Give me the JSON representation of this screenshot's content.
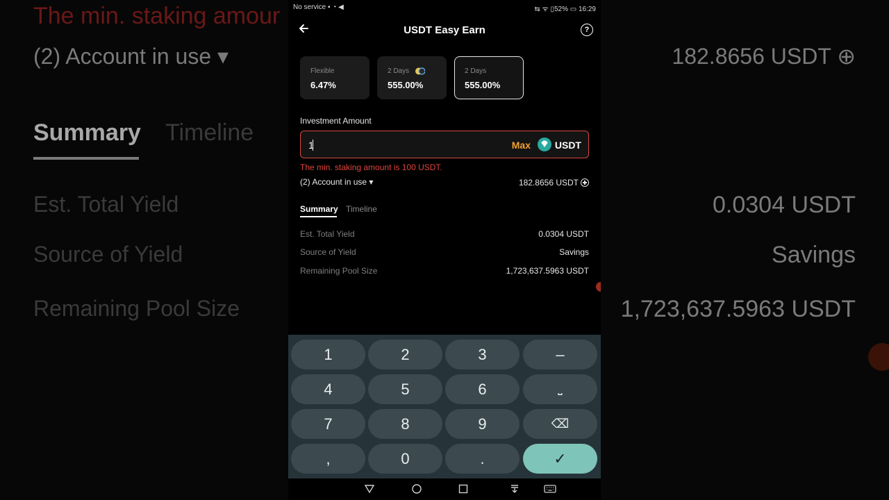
{
  "background": {
    "error_text": "The min. staking amour",
    "account": "(2) Account in use ▾",
    "balance": "182.8656 USDT ⊕",
    "tab_summary": "Summary",
    "tab_timeline": "Timeline",
    "rows": [
      {
        "label": "Est. Total Yield",
        "value": "0.0304 USDT"
      },
      {
        "label": "Source of Yield",
        "value": "Savings"
      },
      {
        "label": "Remaining Pool Size",
        "value": "1,723,637.5963 USDT"
      }
    ]
  },
  "status_bar": {
    "left": "No service ▪ ◔ ◀",
    "right": "⇆ ᯤ ▯52% ▭ 16:29"
  },
  "header": {
    "title": "USDT Easy Earn",
    "back_icon": "arrow-left-icon",
    "help_icon": "question-circle-icon",
    "help_glyph": "?"
  },
  "plans": [
    {
      "label": "Flexible",
      "rate": "6.47%"
    },
    {
      "label": "2 Days",
      "rate": "555.00%"
    },
    {
      "label": "2 Days",
      "rate": "555.00%"
    }
  ],
  "investment": {
    "label": "Investment Amount",
    "value": "1",
    "max_label": "Max",
    "currency": "USDT",
    "error": "The min. staking amount is 100 USDT."
  },
  "account": {
    "label": "(2) Account in use ▾",
    "balance": "182.8656 USDT"
  },
  "tabs": {
    "summary": "Summary",
    "timeline": "Timeline"
  },
  "summary_rows": [
    {
      "label": "Est. Total Yield",
      "value": "0.0304 USDT"
    },
    {
      "label": "Source of Yield",
      "value": "Savings"
    },
    {
      "label": "Remaining Pool Size",
      "value": "1,723,637.5963 USDT"
    }
  ],
  "keypad": {
    "keys": [
      "1",
      "2",
      "3",
      "–",
      "4",
      "5",
      "6",
      "⎵",
      "7",
      "8",
      "9",
      "⌫",
      ",",
      "0",
      ".",
      "✓"
    ]
  },
  "colors": {
    "error": "#e0443b",
    "accent": "#f0a033",
    "keyboard_bg": "#263439",
    "confirm_key": "#7fc4b8"
  }
}
